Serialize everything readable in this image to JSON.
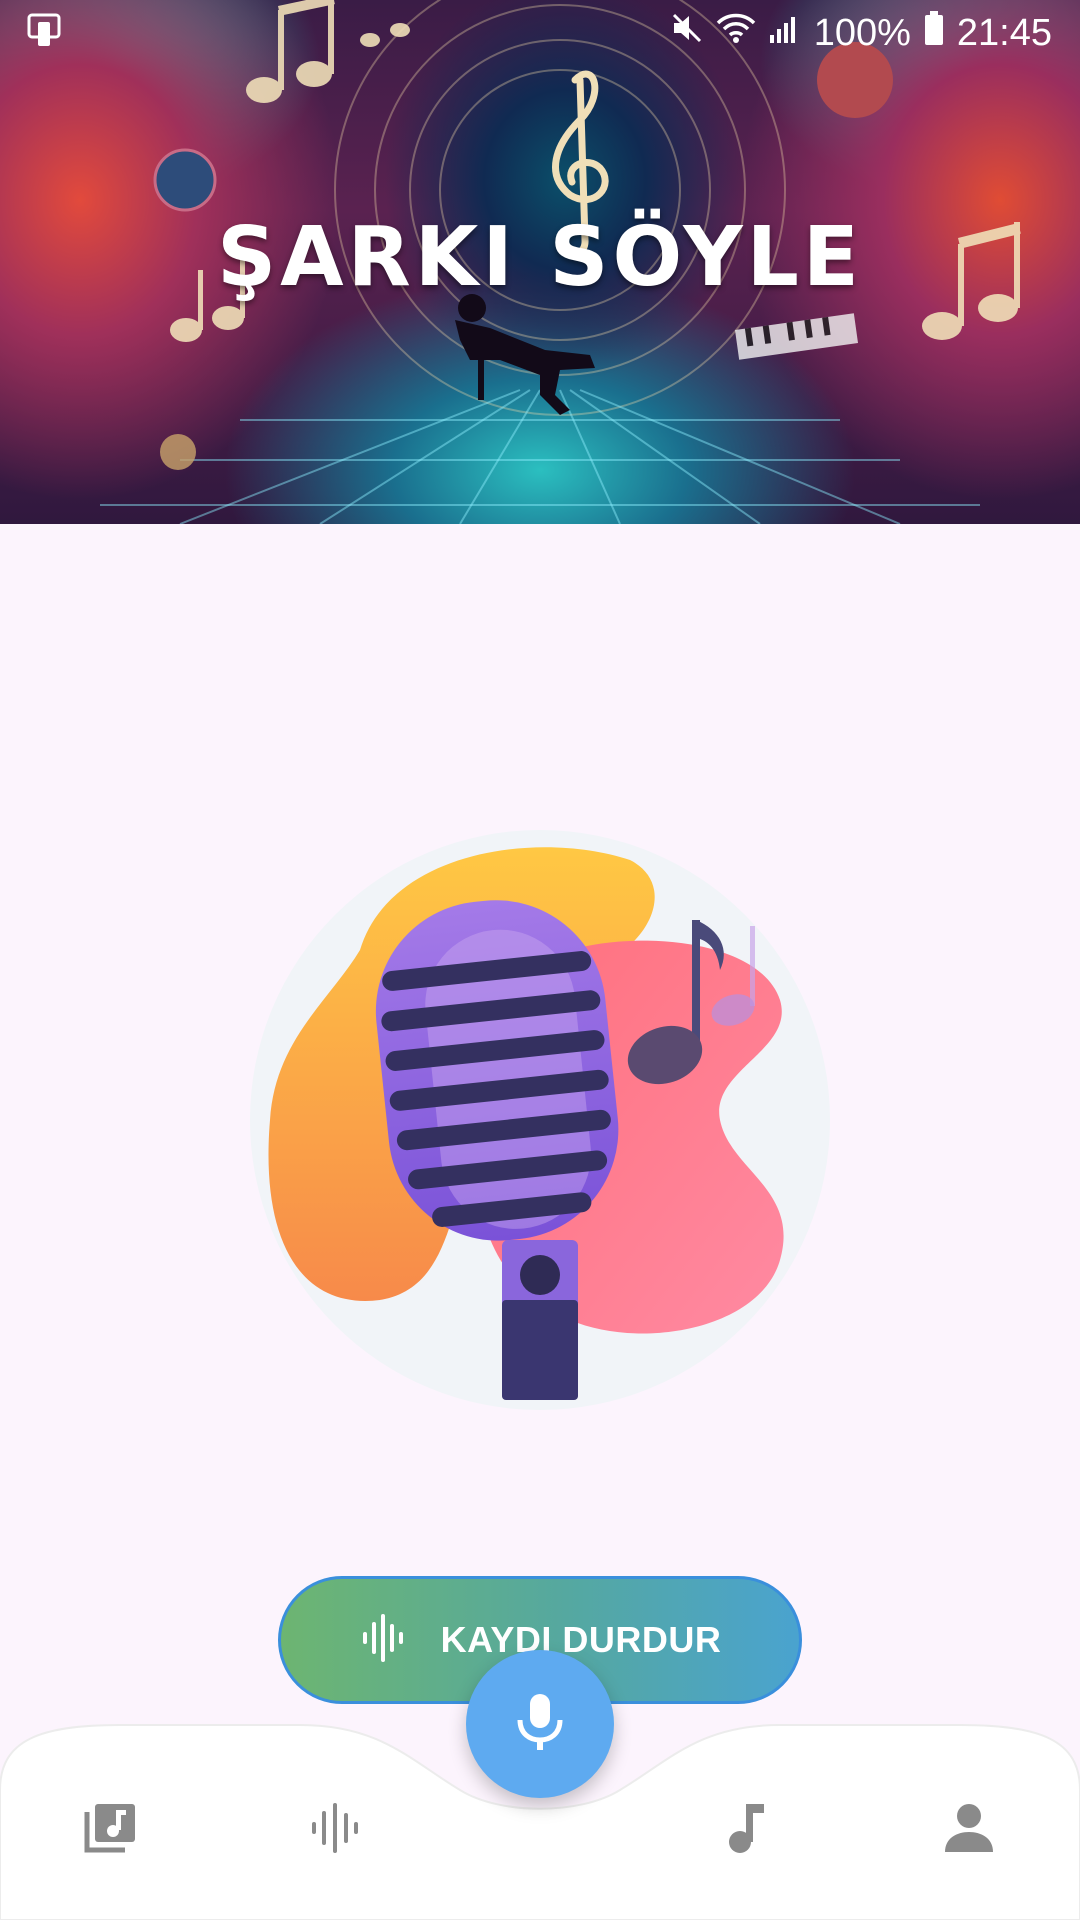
{
  "status_bar": {
    "battery": "100%",
    "time": "21:45",
    "icons": [
      "screen-mirror-icon",
      "mute-icon",
      "wifi-icon",
      "signal-icon",
      "battery-icon"
    ]
  },
  "banner": {
    "title": "ŞARKI SÖYLE"
  },
  "illustration": {
    "icon": "microphone-illustration"
  },
  "record_button": {
    "label": "KAYDI DURDUR",
    "icon": "waveform-icon"
  },
  "fab": {
    "icon": "microphone-icon",
    "color": "#5eaaf0"
  },
  "bottom_nav": {
    "items": [
      {
        "icon": "music-library-icon"
      },
      {
        "icon": "waveform-icon"
      },
      {
        "icon": "music-note-icon"
      },
      {
        "icon": "person-icon"
      }
    ]
  },
  "colors": {
    "background": "#fcf4fd",
    "button_gradient_start": "#6db571",
    "button_gradient_end": "#4aa3cf",
    "nav_icon": "#8a8a8a"
  }
}
